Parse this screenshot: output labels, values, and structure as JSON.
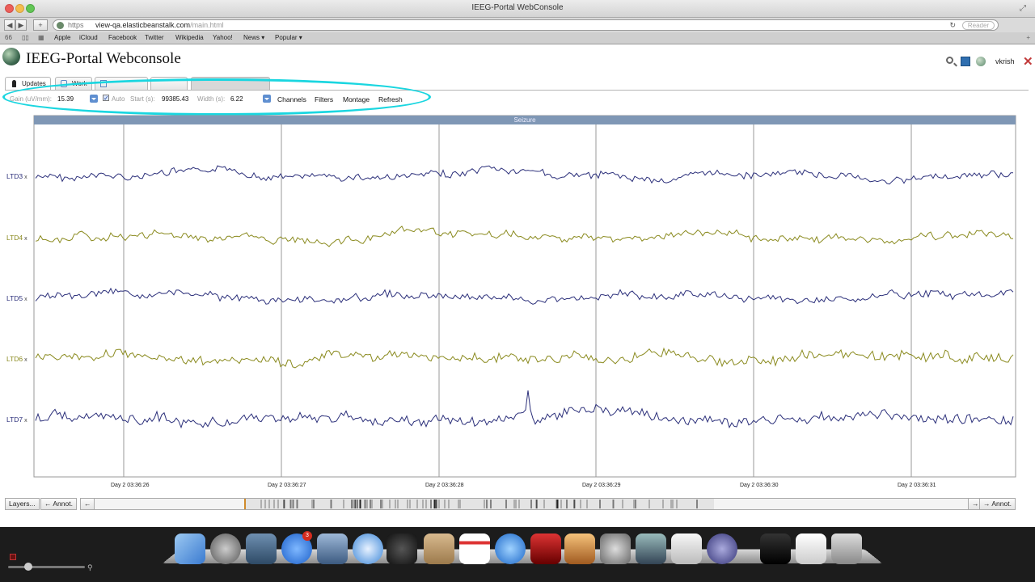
{
  "window": {
    "title": "IEEG-Portal WebConsole"
  },
  "toolbar": {
    "scheme": "https",
    "host": "view-qa.elasticbeanstalk.com",
    "path": "/main.html",
    "reader": "Reader",
    "add_label": "+",
    "back_label": "◀",
    "forward_label": "▶"
  },
  "bookmarks": [
    "Apple",
    "iCloud",
    "Facebook",
    "Twitter",
    "Wikipedia",
    "Yahoo!",
    "News ▾",
    "Popular ▾"
  ],
  "app": {
    "title": "IEEG-Portal Webconsole",
    "username": "vkrish"
  },
  "tabs": [
    {
      "label": "Updates",
      "active": true
    },
    {
      "label": "Work",
      "active": false
    },
    {
      "label": "",
      "active": false
    },
    {
      "label": "",
      "active": false
    },
    {
      "label": "",
      "active": false
    }
  ],
  "controls": {
    "gain_label": "Gain (uV/mm):",
    "gain_value": "15.39",
    "auto_label": "Auto",
    "auto_checked": true,
    "start_label": "Start (s):",
    "start_value": "99385.43",
    "width_label": "Width (s):",
    "width_value": "6.22",
    "buttons": [
      "Channels",
      "Filters",
      "Montage",
      "Refresh"
    ]
  },
  "viewer": {
    "annotation_label": "Seizure",
    "channels": [
      {
        "name": "LTD3",
        "color": "#2b2f7a"
      },
      {
        "name": "LTD4",
        "color": "#8a8a1e"
      },
      {
        "name": "LTD5",
        "color": "#2b2f7a"
      },
      {
        "name": "LTD6",
        "color": "#8a8a1e"
      },
      {
        "name": "LTD7",
        "color": "#2b2f7a"
      }
    ],
    "remove_glyph": "x",
    "time_labels": [
      "Day 2 03:36:26",
      "Day 2 03:36:27",
      "Day 2 03:36:28",
      "Day 2 03:36:29",
      "Day 2 03:36:30",
      "Day 2 03:36:31"
    ]
  },
  "navstrip": {
    "layers": "Layers...",
    "prev_annot": "← Annot.",
    "prev": "←",
    "next": "→",
    "next_annot": "→ Annot."
  },
  "dock": {
    "badge_count": "3"
  }
}
